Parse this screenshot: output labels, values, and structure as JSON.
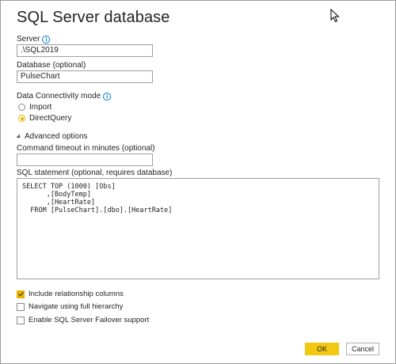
{
  "dialog": {
    "title": "SQL Server database"
  },
  "server": {
    "label": "Server",
    "value": ".\\SQL2019"
  },
  "database": {
    "label": "Database (optional)",
    "value": "PulseChart"
  },
  "connectivity": {
    "label": "Data Connectivity mode",
    "options": [
      {
        "label": "Import",
        "selected": false
      },
      {
        "label": "DirectQuery",
        "selected": true
      }
    ]
  },
  "advanced": {
    "label": "Advanced options",
    "timeout_label": "Command timeout in minutes (optional)",
    "timeout_value": "",
    "sql_label": "SQL statement (optional, requires database)",
    "sql_text": "SELECT TOP (1000) [Obs]\n      ,[BodyTemp]\n      ,[HeartRate]\n  FROM [PulseChart].[dbo].[HeartRate]"
  },
  "options": {
    "include_relationship": {
      "label": "Include relationship columns",
      "checked": true
    },
    "full_hierarchy": {
      "label": "Navigate using full hierarchy",
      "checked": false
    },
    "failover": {
      "label": "Enable SQL Server Failover support",
      "checked": false
    }
  },
  "buttons": {
    "ok": "OK",
    "cancel": "Cancel"
  },
  "colors": {
    "accent": "#F2C811",
    "info": "#0078D4"
  }
}
